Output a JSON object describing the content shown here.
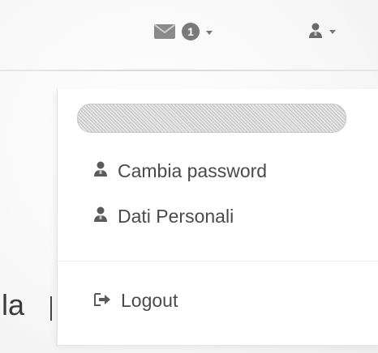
{
  "navbar": {
    "messages": {
      "icon": "envelope-icon",
      "badge_count": "1"
    },
    "user_menu": {
      "icon": "user-icon"
    }
  },
  "dropdown": {
    "header_redacted": true,
    "items": [
      {
        "icon": "user-icon",
        "label": "Cambia password"
      },
      {
        "icon": "user-icon",
        "label": "Dati Personali"
      }
    ],
    "logout": {
      "icon": "sign-out-icon",
      "label": "Logout"
    }
  },
  "background": {
    "partial_text": "la"
  }
}
